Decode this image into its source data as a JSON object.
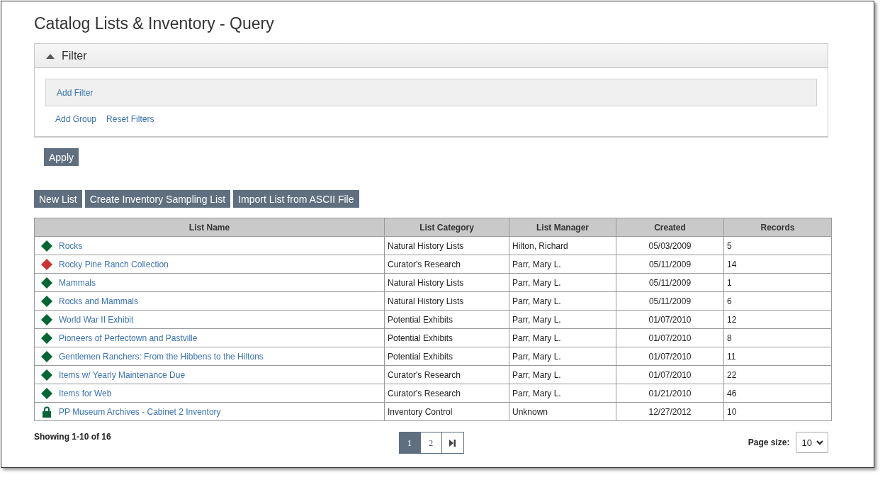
{
  "title": "Catalog Lists & Inventory - Query",
  "filter": {
    "title": "Filter",
    "expanded": true,
    "add_filter": "Add Filter",
    "links": [
      "Add Group",
      "Reset Filters"
    ]
  },
  "apply_button": "Apply",
  "toolbar": [
    "New List",
    "Create Inventory Sampling List",
    "Import List from ASCII File"
  ],
  "table": {
    "columns": [
      "List Name",
      "List Category",
      "List Manager",
      "Created",
      "Records"
    ],
    "rows": [
      {
        "kind": "diamond",
        "color": "#006633",
        "name": "Rocks",
        "category": "Natural History Lists",
        "manager": "Hilton, Richard",
        "created": "05/03/2009",
        "records": "5"
      },
      {
        "kind": "diamond",
        "color": "#cc3333",
        "name": "Rocky Pine Ranch Collection",
        "category": "Curator's Research",
        "manager": "Parr, Mary L.",
        "created": "05/11/2009",
        "records": "14"
      },
      {
        "kind": "diamond",
        "color": "#006633",
        "name": "Mammals",
        "category": "Natural History Lists",
        "manager": "Parr, Mary L.",
        "created": "05/11/2009",
        "records": "1"
      },
      {
        "kind": "diamond",
        "color": "#006633",
        "name": "Rocks and Mammals",
        "category": "Natural History Lists",
        "manager": "Parr, Mary L.",
        "created": "05/11/2009",
        "records": "6"
      },
      {
        "kind": "diamond",
        "color": "#006633",
        "name": "World War II Exhibit",
        "category": "Potential Exhibits",
        "manager": "Parr, Mary L.",
        "created": "01/07/2010",
        "records": "12"
      },
      {
        "kind": "diamond",
        "color": "#006633",
        "name": "Pioneers of Perfectown and Pastville",
        "category": "Potential Exhibits",
        "manager": "Parr, Mary L.",
        "created": "01/07/2010",
        "records": "8"
      },
      {
        "kind": "diamond",
        "color": "#006633",
        "name": "Gentlemen Ranchers: From the Hibbens to the Hiltons",
        "category": "Potential Exhibits",
        "manager": "Parr, Mary L.",
        "created": "01/07/2010",
        "records": "11"
      },
      {
        "kind": "diamond",
        "color": "#006633",
        "name": "Items w/ Yearly Maintenance Due",
        "category": "Curator's Research",
        "manager": "Parr, Mary L.",
        "created": "01/07/2010",
        "records": "22"
      },
      {
        "kind": "diamond",
        "color": "#006633",
        "name": "Items for Web",
        "category": "Curator's Research",
        "manager": "Parr, Mary L.",
        "created": "01/21/2010",
        "records": "46"
      },
      {
        "kind": "lock",
        "color": "#006633",
        "name": "PP Museum Archives - Cabinet 2 Inventory",
        "category": "Inventory Control",
        "manager": "Unknown",
        "created": "12/27/2012",
        "records": "10"
      }
    ]
  },
  "footer": {
    "showing": "Showing 1-10 of 16",
    "pages": [
      {
        "label": "1",
        "selected": true
      },
      {
        "label": "2",
        "selected": false
      }
    ],
    "page_size_label": "Page size:",
    "page_size": "10"
  }
}
